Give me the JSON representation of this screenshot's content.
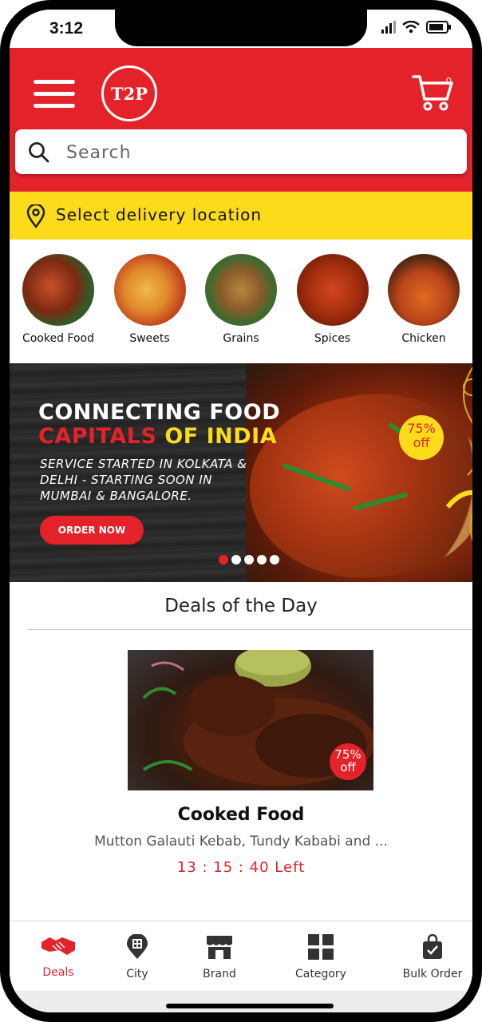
{
  "status": {
    "time": "3:12"
  },
  "header": {
    "logo_text": "T2P",
    "cart_count": "0"
  },
  "search": {
    "placeholder": "Search"
  },
  "location": {
    "label": "Select delivery location"
  },
  "categories": [
    {
      "label": "Cooked Food"
    },
    {
      "label": "Sweets"
    },
    {
      "label": "Grains"
    },
    {
      "label": "Spices"
    },
    {
      "label": "Chicken"
    }
  ],
  "banner": {
    "title_line1": "CONNECTING FOOD",
    "title_capitals": "CAPITALS",
    "title_of_india": " OF INDIA",
    "subtitle": "SERVICE STARTED IN KOLKATA & DELHI - STARTING SOON IN MUMBAI & BANGALORE.",
    "button": "ORDER NOW",
    "badge_pct": "75%",
    "badge_off": "off",
    "slides": 5,
    "active_slide": 1
  },
  "deals": {
    "title": "Deals of the Day",
    "item_name": "Cooked Food",
    "item_desc": "Mutton Galauti Kebab, Tundy Kababi and ...",
    "timer": "13 : 15 : 40 Left",
    "badge_pct": "75%",
    "badge_off": "off"
  },
  "nav": [
    {
      "label": "Deals",
      "icon": "handshake-icon",
      "active": true
    },
    {
      "label": "City",
      "icon": "city-pin-icon",
      "active": false
    },
    {
      "label": "Brand",
      "icon": "store-icon",
      "active": false
    },
    {
      "label": "Category",
      "icon": "grid-icon",
      "active": false
    },
    {
      "label": "Bulk Order",
      "icon": "shopping-bag-icon",
      "active": false
    }
  ],
  "colors": {
    "primary": "#e4222a",
    "accent": "#fcdb1a"
  }
}
